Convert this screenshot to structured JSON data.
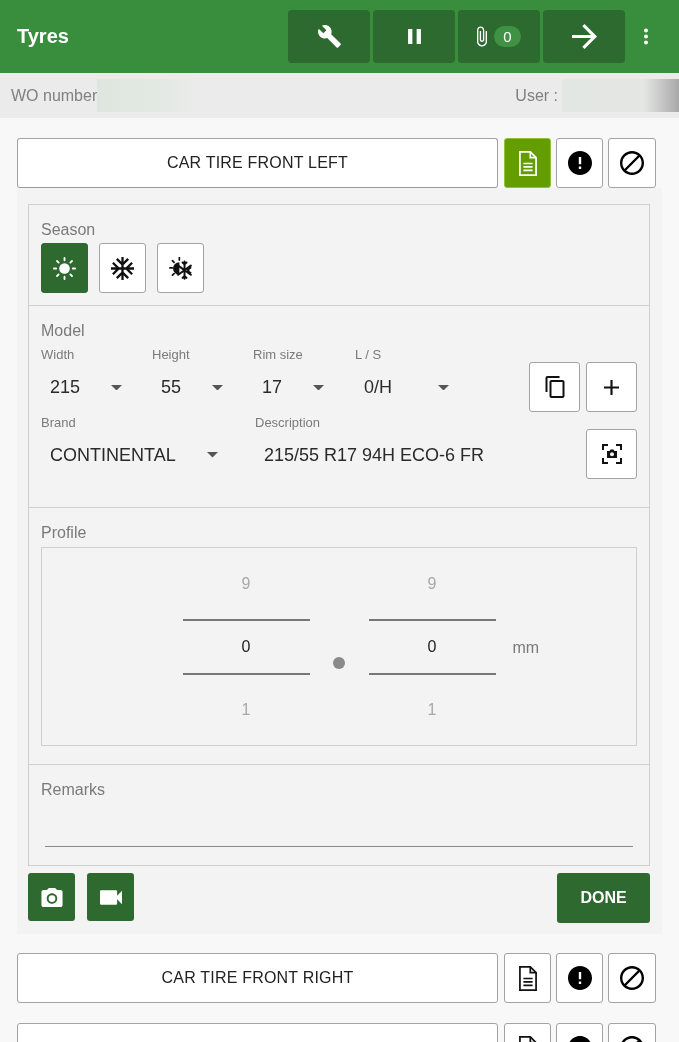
{
  "app_bar": {
    "title": "Tyres",
    "attachment_count": "0"
  },
  "info_bar": {
    "wo_label": "WO number",
    "user_label": "User :"
  },
  "tyres": [
    {
      "label": "CAR TIRE FRONT LEFT",
      "note_active": true,
      "expanded": true,
      "details": {
        "season": {
          "label": "Season",
          "options": [
            {
              "kind": "summer",
              "selected": true
            },
            {
              "kind": "winter",
              "selected": false
            },
            {
              "kind": "all_season",
              "selected": false
            }
          ]
        },
        "model": {
          "label": "Model",
          "dropdowns": [
            {
              "label": "Width",
              "value": "215"
            },
            {
              "label": "Height",
              "value": "55"
            },
            {
              "label": "Rim size",
              "value": "17"
            },
            {
              "label": "L / S",
              "value": "0/H"
            }
          ],
          "brand": {
            "label": "Brand",
            "value": "CONTINENTAL"
          },
          "description": {
            "label": "Description",
            "value": "215/55 R17 94H ECO-6 FR"
          }
        },
        "profile": {
          "label": "Profile",
          "pickers": [
            {
              "above": "9",
              "value": "0",
              "below": "1"
            },
            {
              "above": "9",
              "value": "0",
              "below": "1"
            }
          ],
          "unit": "mm"
        },
        "remarks": {
          "label": "Remarks"
        },
        "done_label": "DONE"
      }
    },
    {
      "label": "CAR TIRE FRONT RIGHT",
      "note_active": false,
      "expanded": false
    },
    {
      "note_active": false,
      "expanded": false
    }
  ]
}
